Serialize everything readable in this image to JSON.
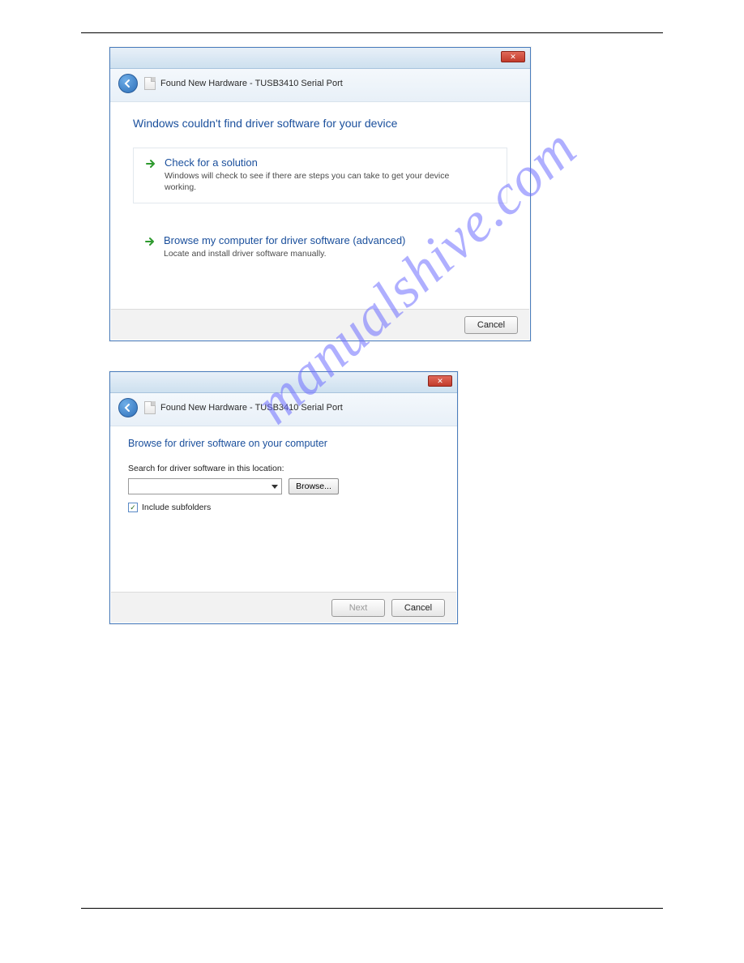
{
  "watermark": "manualshive.com",
  "dialog1": {
    "window_title": "Found New Hardware - TUSB3410 Serial Port",
    "close_label": "✕",
    "heading": "Windows couldn't find driver software for your device",
    "option1": {
      "title": "Check for a solution",
      "desc": "Windows will check to see if there are steps you can take to get your device working."
    },
    "option2": {
      "title": "Browse my computer for driver software (advanced)",
      "desc": "Locate and install driver software manually."
    },
    "cancel": "Cancel"
  },
  "dialog2": {
    "window_title": "Found New Hardware - TUSB3410 Serial Port",
    "close_label": "✕",
    "heading": "Browse for driver software on your computer",
    "search_label": "Search for driver software in this location:",
    "path_value": "",
    "browse": "Browse...",
    "subfolders": "Include subfolders",
    "next": "Next",
    "cancel": "Cancel"
  }
}
